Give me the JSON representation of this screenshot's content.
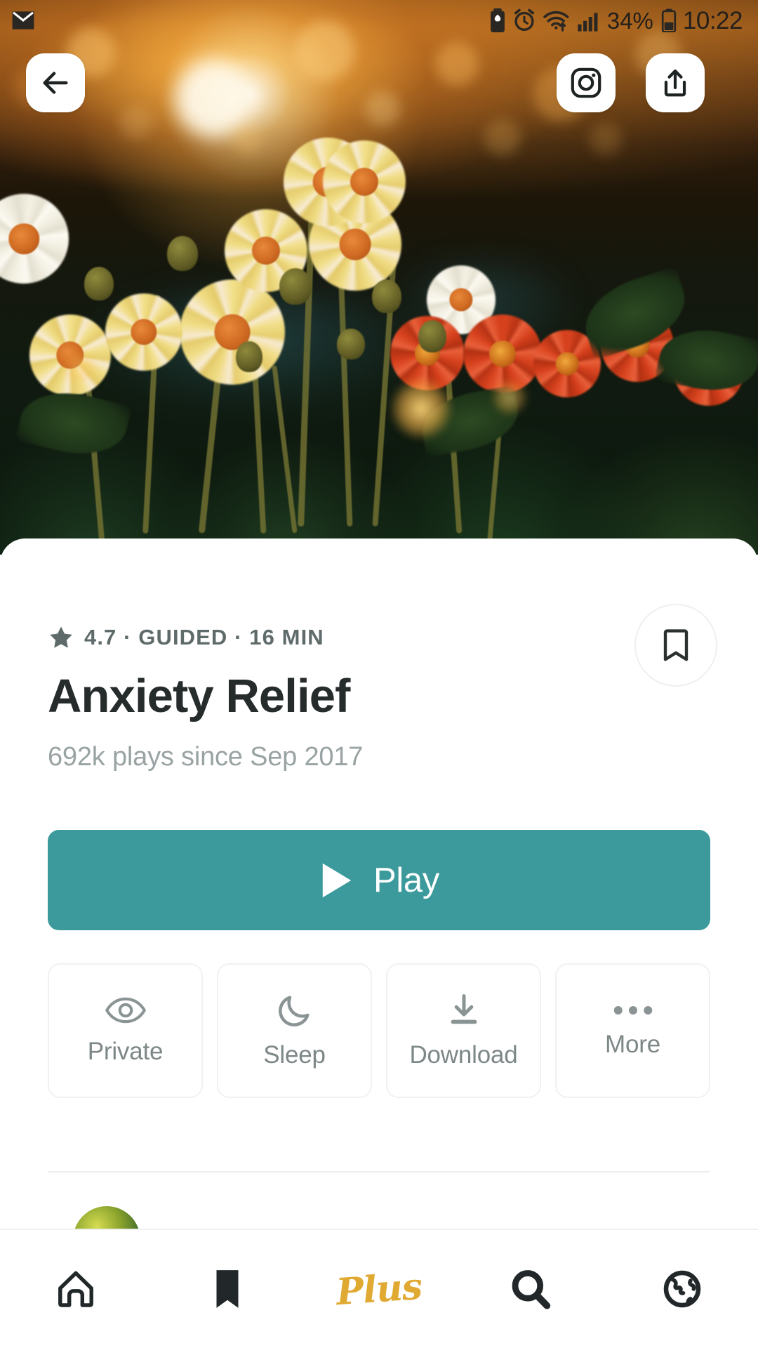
{
  "status_bar": {
    "time": "10:22",
    "battery_percent": "34%",
    "icons": [
      "email-icon",
      "battery-saver-icon",
      "alarm-clock-icon",
      "wifi-icon",
      "cellular-signal-icon",
      "battery-icon"
    ]
  },
  "hero": {
    "image_description": "yellow dahlia flowers at sunset with bokeh background",
    "back_button": "back-arrow-icon",
    "instagram_button": "instagram-icon",
    "share_button": "share-icon"
  },
  "session": {
    "rating": "4.7",
    "meta_line": "4.7 · GUIDED · 16 MIN",
    "type": "GUIDED",
    "duration": "16 MIN",
    "title": "Anxiety Relief",
    "subtitle": "692k plays since Sep 2017",
    "play_label": "Play",
    "bookmark_icon": "bookmark-icon"
  },
  "actions": [
    {
      "label": "Private",
      "icon": "eye-icon"
    },
    {
      "label": "Sleep",
      "icon": "moon-icon"
    },
    {
      "label": "Download",
      "icon": "download-icon"
    },
    {
      "label": "More",
      "icon": "ellipsis-icon"
    }
  ],
  "bottom_nav": [
    {
      "name": "home",
      "icon": "home-icon",
      "label": ""
    },
    {
      "name": "bookmarks",
      "icon": "bookmark-icon",
      "label": ""
    },
    {
      "name": "plus",
      "icon": "plus-wordmark",
      "label": "Plus"
    },
    {
      "name": "search",
      "icon": "search-icon",
      "label": ""
    },
    {
      "name": "explore",
      "icon": "globe-icon",
      "label": ""
    }
  ],
  "colors": {
    "accent_teal": "#3c9a9c",
    "plus_gold": "#e0a932",
    "title_text": "#262b2b",
    "muted_text": "#9aa3a3",
    "meta_text": "#5f6b6b"
  }
}
